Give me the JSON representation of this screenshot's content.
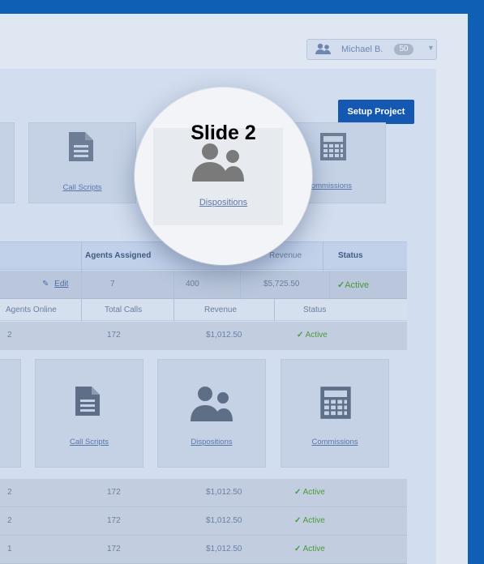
{
  "user": {
    "name": "Michael B.",
    "count": "50"
  },
  "setup_button": "Setup Project",
  "top_cards": {
    "call_scripts": "Call Scripts",
    "dispositions": "Dispositions",
    "commissions": "Commissions"
  },
  "lens": {
    "title": "Slide 2",
    "label": "Dispositions"
  },
  "table1": {
    "headers": {
      "agents_assigned": "Agents Assigned",
      "revenue": "Revenue",
      "status": "Status"
    },
    "row": {
      "edit": "Edit",
      "agents": "7",
      "calls": "400",
      "revenue": "$5,725.50",
      "status": "Active"
    }
  },
  "table2": {
    "headers": {
      "agents_online": "Agents Online",
      "total_calls": "Total Calls",
      "revenue": "Revenue",
      "status": "Status"
    },
    "row": {
      "agents": "2",
      "calls": "172",
      "revenue": "$1,012.50",
      "status": "Active"
    }
  },
  "bottom_cards": {
    "call_scripts": "Call Scripts",
    "dispositions": "Dispositions",
    "commissions": "Commissions"
  },
  "bottom_rows": [
    {
      "agents": "2",
      "calls": "172",
      "revenue": "$1,012.50",
      "status": "Active"
    },
    {
      "agents": "2",
      "calls": "172",
      "revenue": "$1,012.50",
      "status": "Active"
    },
    {
      "agents": "1",
      "calls": "172",
      "revenue": "$1,012.50",
      "status": "Active"
    }
  ],
  "colors": {
    "brand_blue": "#1458b1",
    "background": "#0f5fb4",
    "active_green": "#4a9a3a"
  }
}
